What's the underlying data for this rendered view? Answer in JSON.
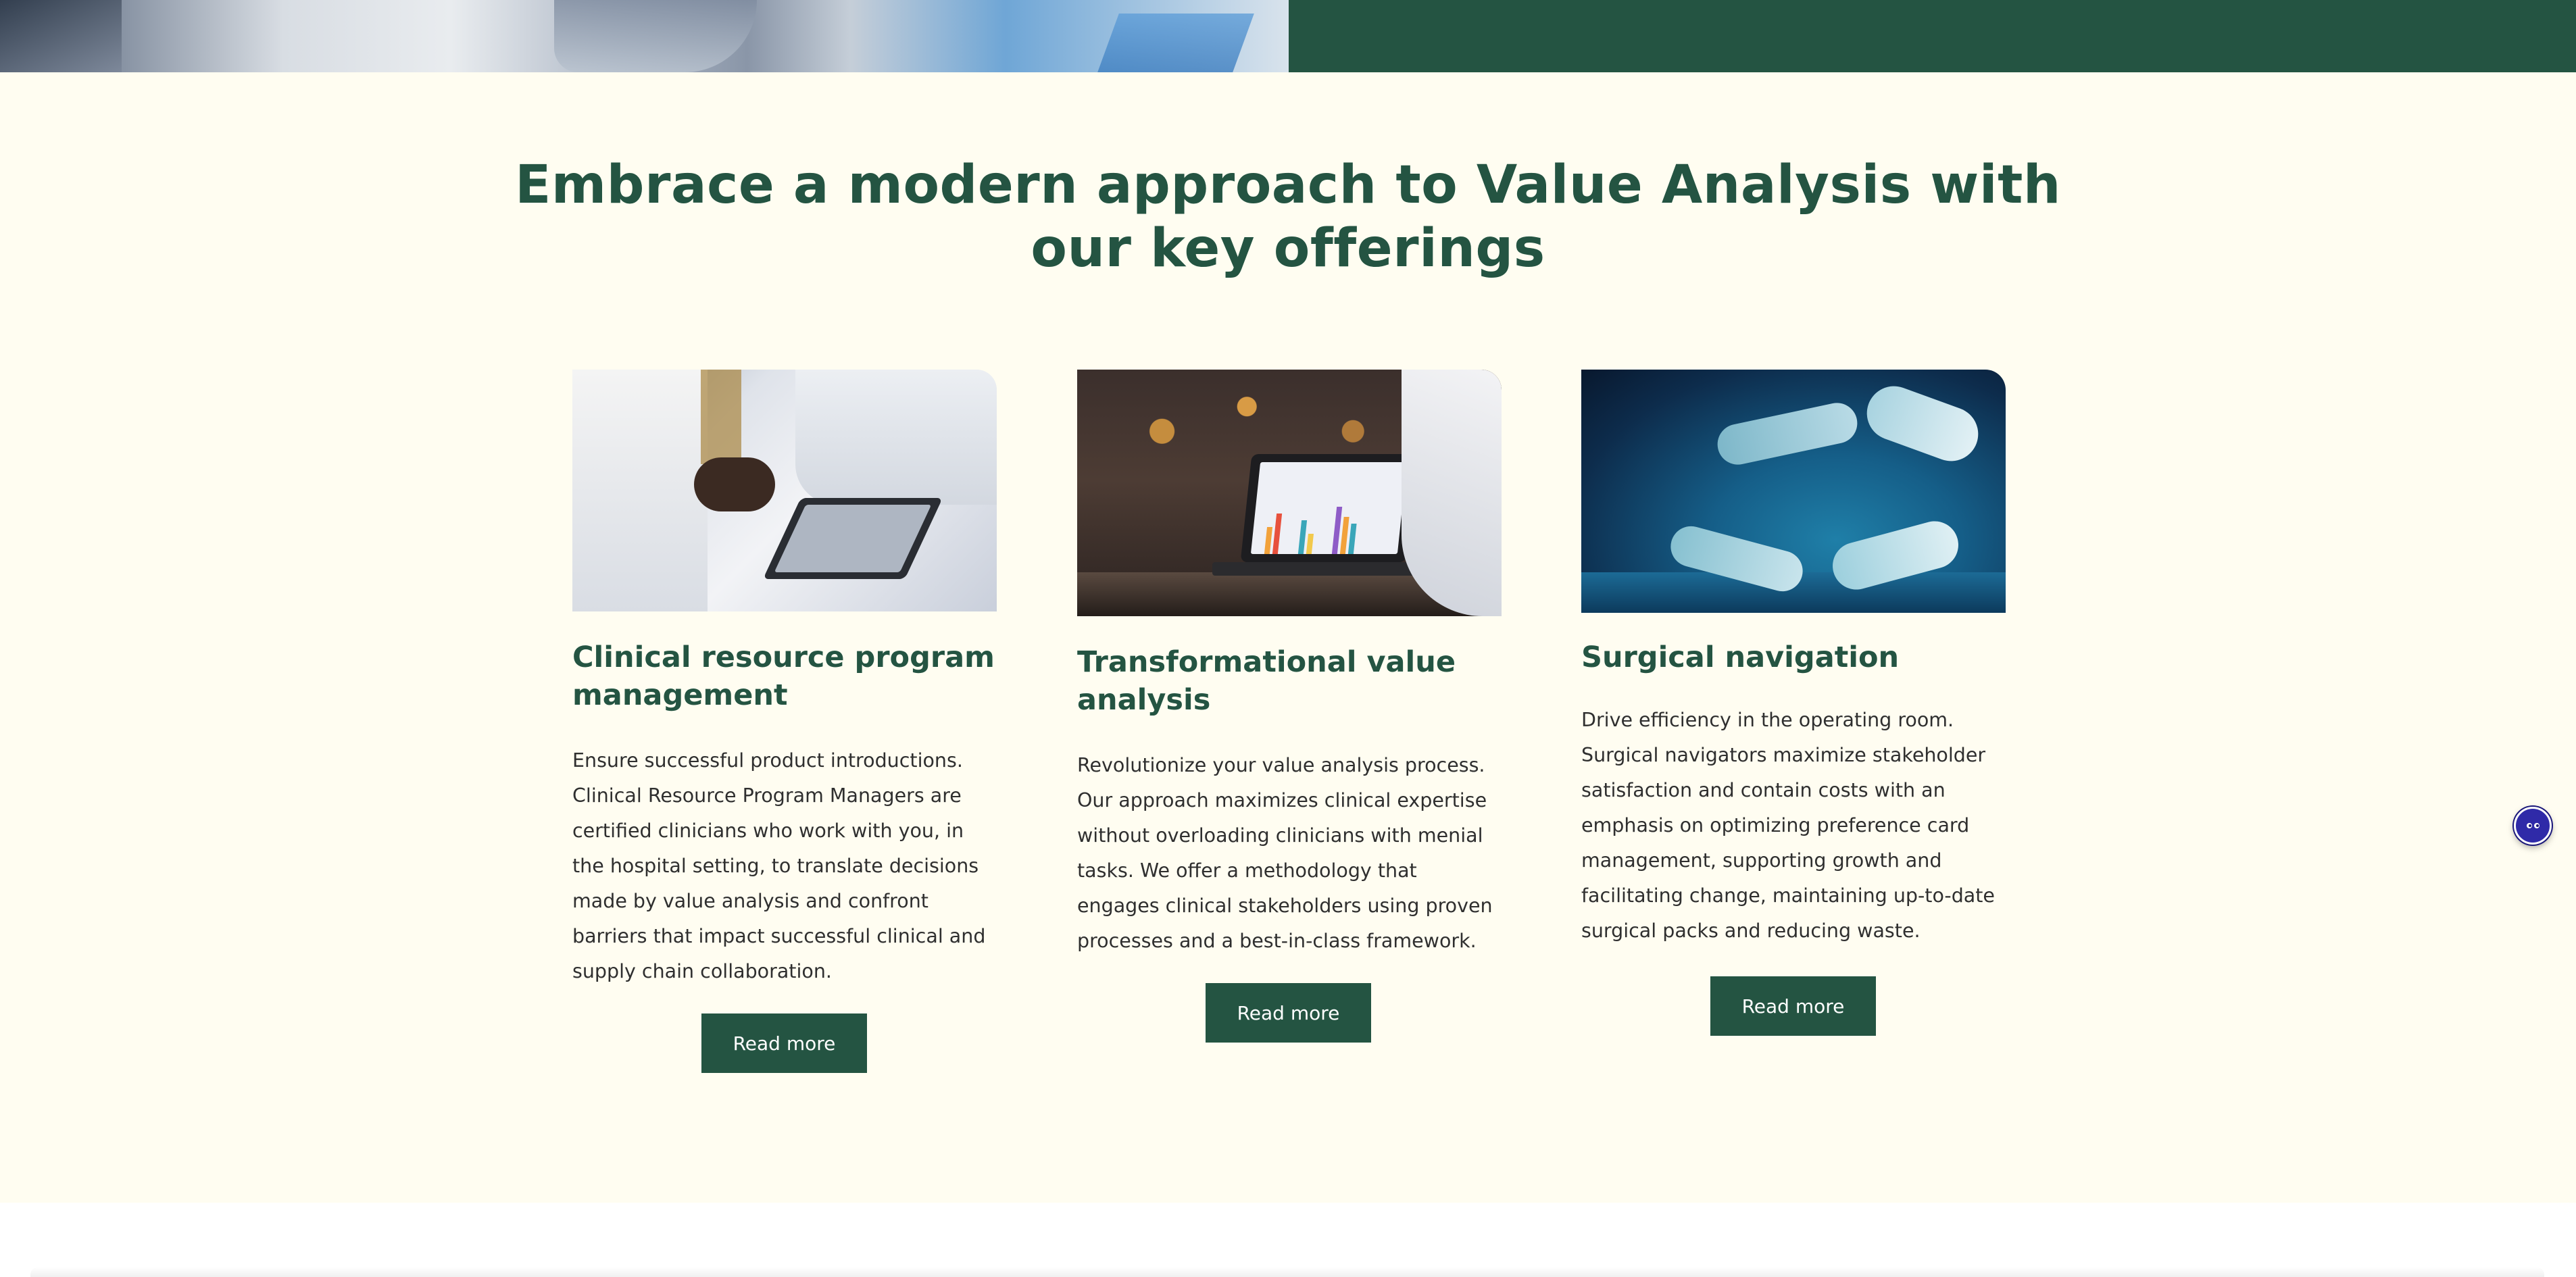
{
  "section": {
    "title": "Embrace a modern approach to Value Analysis with our key offerings"
  },
  "cards": [
    {
      "title": "Clinical resource program management",
      "body": "Ensure successful product introductions. Clinical Resource Program Managers are certified clinicians who work with you, in the hospital setting, to translate decisions made by value analysis and confront barriers that impact successful clinical and supply chain collaboration.",
      "button_label": "Read more"
    },
    {
      "title": "Transformational value analysis",
      "body": "Revolutionize your value analysis process. Our approach maximizes clinical expertise without overloading clinicians with menial tasks. We offer a methodology that engages clinical stakeholders using proven processes and a best-in-class framework.",
      "button_label": "Read more"
    },
    {
      "title": "Surgical navigation",
      "body": "Drive efficiency in the operating room. Surgical navigators maximize stakeholder satisfaction and contain costs with an emphasis on optimizing preference card management, supporting growth and facilitating change, maintaining up-to-date surgical packs and reducing waste.",
      "button_label": "Read more"
    }
  ],
  "colors": {
    "brand_green": "#245442",
    "page_background": "#fffdf1",
    "widget_blue": "#2f2aa8"
  },
  "icons": {
    "accessibility_widget": "accessibility-eyes-icon"
  }
}
